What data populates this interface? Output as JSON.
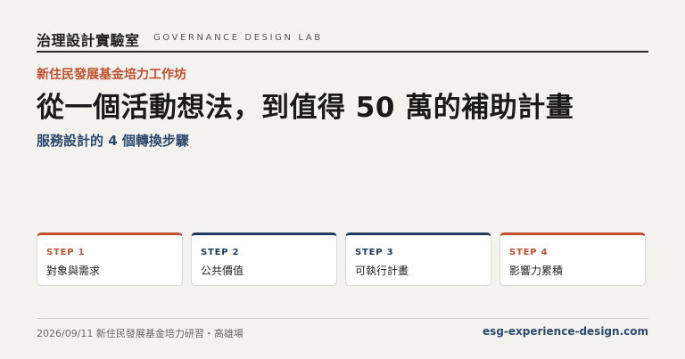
{
  "header": {
    "org_name": "治理設計實驗室",
    "org_subtitle": "GOVERNANCE DESIGN LAB"
  },
  "kicker": "新住民發展基金培力工作坊",
  "headline": "從一個活動想法，到值得 50 萬的補助計畫",
  "subhead": "服務設計的 4 個轉換步驟",
  "steps": [
    {
      "num": "STEP 1",
      "title": "對象與需求"
    },
    {
      "num": "STEP 2",
      "title": "公共價值"
    },
    {
      "num": "STEP 3",
      "title": "可執行計畫"
    },
    {
      "num": "STEP 4",
      "title": "影響力累積"
    }
  ],
  "footer": {
    "event": "2026/09/11 新住民發展基金培力研習・高雄場",
    "site": "esg-experience-design.com"
  },
  "colors": {
    "accent": "#c1502e",
    "navy": "#1f3a5c",
    "background": "#f4f2ee"
  }
}
